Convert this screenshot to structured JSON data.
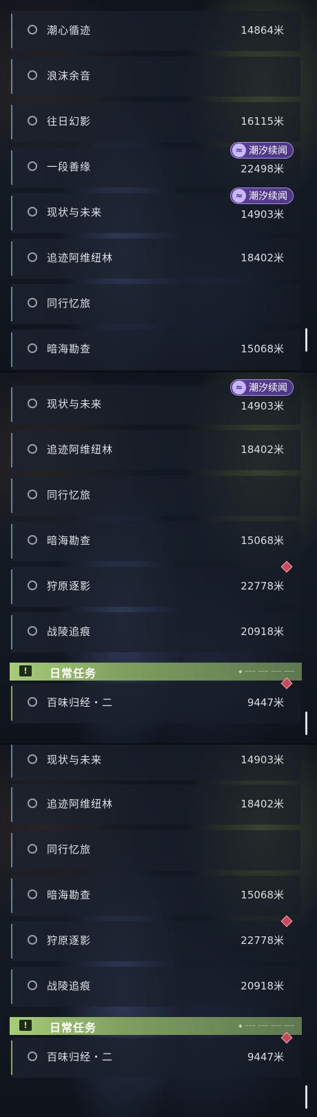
{
  "badge_label": "潮汐续闻",
  "badge_icon": "wave-emblem-icon",
  "accent_colors": {
    "badge": "#5b3f9a",
    "daily_section": "#a7cd78",
    "alert": "#c84a5a"
  },
  "panels": [
    {
      "quests": [
        {
          "name": "潮心循迹",
          "distance": "14864米"
        },
        {
          "name": "浪沫余音",
          "distance": ""
        },
        {
          "name": "往日幻影",
          "distance": "16115米"
        },
        {
          "name": "一段善缘",
          "distance": "22498米",
          "badge": true
        },
        {
          "name": "现状与未来",
          "distance": "14903米",
          "badge": true
        },
        {
          "name": "追迹阿维纽林",
          "distance": "18402米"
        },
        {
          "name": "同行忆旅",
          "distance": ""
        },
        {
          "name": "暗海勘查",
          "distance": "15068米"
        }
      ]
    },
    {
      "quests": [
        {
          "name": "现状与未来",
          "distance": "14903米",
          "badge": true
        },
        {
          "name": "追迹阿维纽林",
          "distance": "18402米"
        },
        {
          "name": "同行忆旅",
          "distance": ""
        },
        {
          "name": "暗海勘查",
          "distance": "15068米"
        },
        {
          "name": "狩原逐影",
          "distance": "22778米",
          "alert": true
        },
        {
          "name": "战陵追痕",
          "distance": "20918米"
        }
      ],
      "section": {
        "title": "日常任务",
        "icon": "!"
      },
      "daily": [
        {
          "name": "百味归经・二",
          "distance": "9447米",
          "alert": true
        }
      ]
    },
    {
      "quests": [
        {
          "name": "现状与未来",
          "distance": "14903米"
        },
        {
          "name": "追迹阿维纽林",
          "distance": "18402米"
        },
        {
          "name": "同行忆旅",
          "distance": ""
        },
        {
          "name": "暗海勘查",
          "distance": "15068米"
        },
        {
          "name": "狩原逐影",
          "distance": "22778米",
          "alert": true
        },
        {
          "name": "战陵追痕",
          "distance": "20918米"
        }
      ],
      "section": {
        "title": "日常任务",
        "icon": "!"
      },
      "daily": [
        {
          "name": "百味归经・二",
          "distance": "9447米",
          "alert": true
        }
      ]
    }
  ]
}
